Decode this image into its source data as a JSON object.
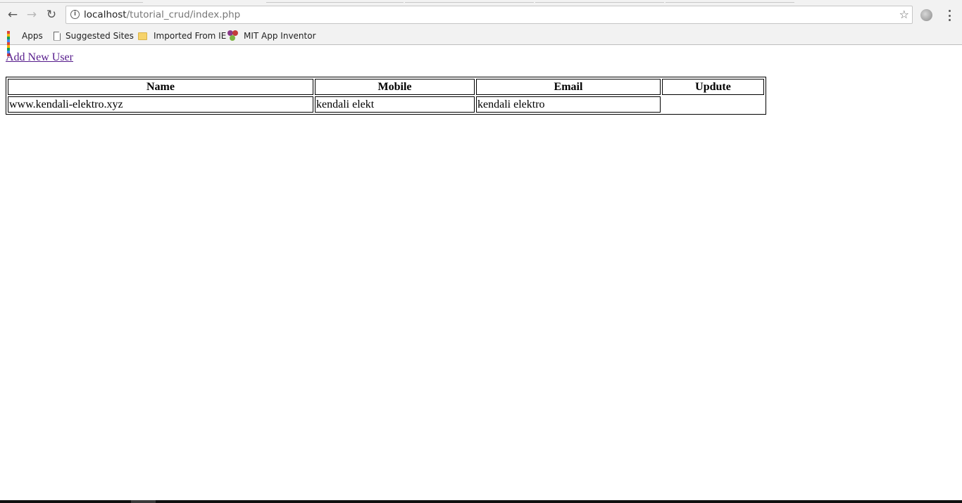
{
  "browser": {
    "address": {
      "host": "localhost",
      "path": "/tutorial_crud/index.php"
    },
    "icons": {
      "back": "back-arrow-icon",
      "forward": "forward-arrow-icon",
      "reload": "reload-icon",
      "info": "info-icon",
      "bookmark": "star-icon",
      "extension": "extension-icon",
      "menu": "kebab-menu-icon"
    },
    "bookmarks": [
      {
        "label": "Apps",
        "icon": "apps-grid-icon"
      },
      {
        "label": "Suggested Sites",
        "icon": "page-icon"
      },
      {
        "label": "Imported From IE",
        "icon": "folder-icon"
      },
      {
        "label": "MIT App Inventor",
        "icon": "mit-app-inventor-icon"
      }
    ]
  },
  "page": {
    "add_link": "Add New User",
    "link_color": "#551a8b",
    "table": {
      "headers": [
        "Name",
        "Mobile",
        "Email",
        "Updute"
      ],
      "rows": [
        [
          "www.kendali-elektro.xyz",
          "kendali elekt",
          "kendali elektro",
          ""
        ]
      ]
    }
  }
}
